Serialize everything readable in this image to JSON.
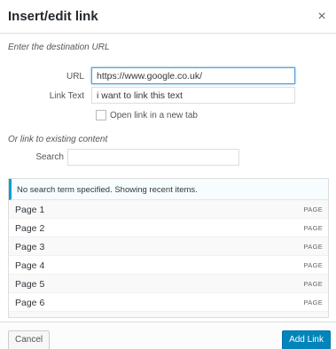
{
  "dialog": {
    "title": "Insert/edit link",
    "close_icon": "close-icon",
    "close_glyph": "×"
  },
  "destination": {
    "section_label": "Enter the destination URL",
    "url_label": "URL",
    "url_value": "https://www.google.co.uk/",
    "link_text_label": "Link Text",
    "link_text_value": "i want to link this text",
    "new_tab_label": "Open link in a new tab",
    "new_tab_checked": false
  },
  "existing": {
    "section_label": "Or link to existing content",
    "search_label": "Search",
    "search_value": "",
    "notice": "No search term specified. Showing recent items.",
    "items": [
      {
        "title": "Page 1",
        "type": "PAGE"
      },
      {
        "title": "Page 2",
        "type": "PAGE"
      },
      {
        "title": "Page 3",
        "type": "PAGE"
      },
      {
        "title": "Page 4",
        "type": "PAGE"
      },
      {
        "title": "Page 5",
        "type": "PAGE"
      },
      {
        "title": "Page 6",
        "type": "PAGE"
      }
    ]
  },
  "footer": {
    "cancel_label": "Cancel",
    "add_link_label": "Add Link"
  },
  "colors": {
    "accent": "#0085ba",
    "notice_border": "#00a0d2",
    "focus_border": "#5b9dd9"
  }
}
